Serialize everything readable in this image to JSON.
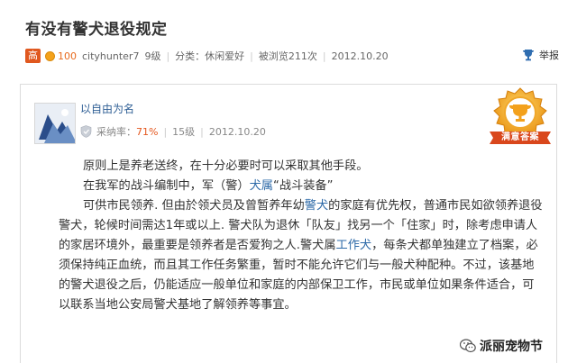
{
  "question": {
    "title": "有没有警犬退役规定",
    "meta": {
      "rank_badge": "高",
      "coins": "100",
      "username": "cityhunter7",
      "level": "9级",
      "category": "分类：休闲爱好",
      "views": "被浏览211次",
      "date": "2012.10.20"
    },
    "report_label": "举报"
  },
  "answer": {
    "answerer": "以自由为名",
    "adoption_rate_label": "采纳率：",
    "adoption_rate": "71%",
    "level": "15级",
    "date": "2012.10.20",
    "best_badge": "满意答案",
    "paragraphs": {
      "p1": "原则上是养老送终，在十分必要时可以采取其他手段。",
      "p2_a": "在我军的战斗编制中，军（警）",
      "p2_link": "犬属",
      "p2_b": "“战斗装备”",
      "p3_a": "可供市民领养. 但由於领犬员及曾暂养年幼",
      "p3_link1": "警犬",
      "p3_b": "的家庭有优先权，普通市民如欲领养退役警犬，轮候时间需达1年或以上. 警犬队为退休「队友」找另一个「住家」时，除考虑申请人的家居环境外，最重要是领养者是否爱狗之人.警犬属",
      "p3_link2": "工作犬",
      "p3_c": "，每条犬都单独建立了档案，必须保持纯正血统，而且其工作任务繁重，暂时不能允许它们与一般犬种配种。不过，该基地的警犬退役之后，仍能适应一般单位和家庭的内部保卫工作，市民或单位如果条件适合，可以联系当地公安局警犬基地了解领养等事宜。"
    }
  },
  "watermark": "派丽宠物节",
  "icons": {
    "coin": "coin-icon",
    "report": "trophy-icon",
    "shield": "shield-icon",
    "best": "best-answer-trophy-icon",
    "wechat": "wechat-icon"
  },
  "colors": {
    "rank_badge": "#e0581f",
    "coin_text": "#e76a1d",
    "link": "#2e6aa8",
    "rate": "#e4571e",
    "badge_gold": "#f3a11c",
    "badge_ribbon": "#d9471c"
  }
}
